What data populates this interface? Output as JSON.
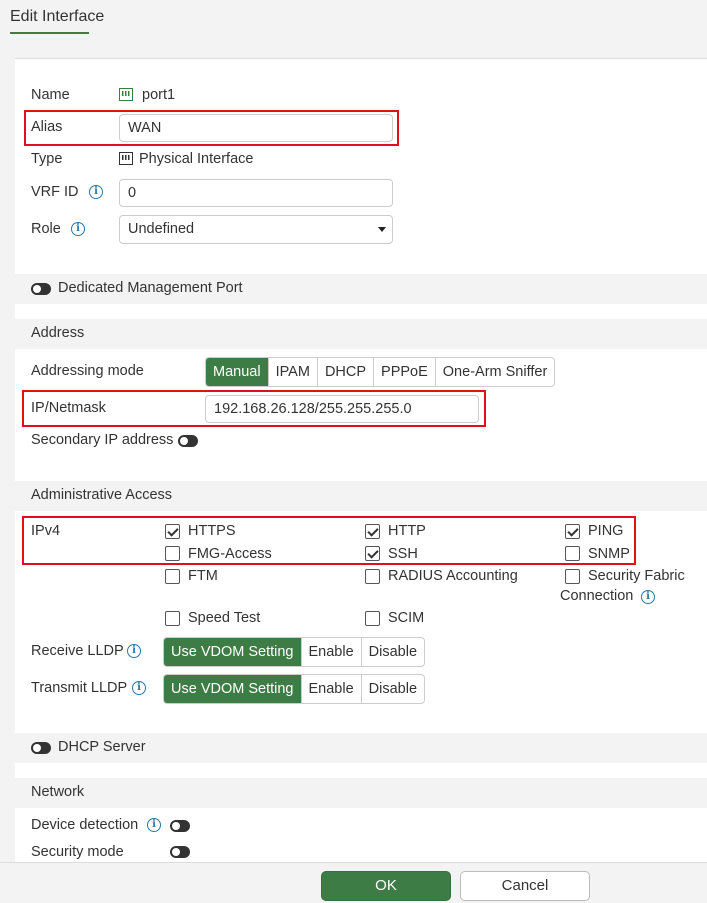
{
  "header": {
    "title": "Edit Interface"
  },
  "fields": {
    "name_label": "Name",
    "name_value": "port1",
    "alias_label": "Alias",
    "alias_value": "WAN",
    "type_label": "Type",
    "type_value": "Physical Interface",
    "vrf_label": "VRF ID",
    "vrf_value": "0",
    "role_label": "Role",
    "role_value": "Undefined"
  },
  "dedicated_mgmt": {
    "label": "Dedicated Management Port",
    "enabled": false
  },
  "address": {
    "section_title": "Address",
    "mode_label": "Addressing mode",
    "modes": [
      "Manual",
      "IPAM",
      "DHCP",
      "PPPoE",
      "One-Arm Sniffer"
    ],
    "selected_mode": "Manual",
    "ip_label": "IP/Netmask",
    "ip_value": "192.168.26.128/255.255.255.0",
    "secondary_label": "Secondary IP address",
    "secondary_enabled": false
  },
  "admin_access": {
    "section_title": "Administrative Access",
    "ipv4_label": "IPv4",
    "options": [
      {
        "label": "HTTPS",
        "checked": true
      },
      {
        "label": "HTTP",
        "checked": true
      },
      {
        "label": "PING",
        "checked": true
      },
      {
        "label": "FMG-Access",
        "checked": false
      },
      {
        "label": "SSH",
        "checked": true
      },
      {
        "label": "SNMP",
        "checked": false
      },
      {
        "label": "FTM",
        "checked": false
      },
      {
        "label": "RADIUS Accounting",
        "checked": false
      },
      {
        "label": "Security Fabric",
        "label2": "Connection",
        "checked": false
      },
      {
        "label": "Speed Test",
        "checked": false
      },
      {
        "label": "SCIM",
        "checked": false
      }
    ],
    "receive_lldp_label": "Receive LLDP",
    "transmit_lldp_label": "Transmit LLDP",
    "lldp_options": [
      "Use VDOM Setting",
      "Enable",
      "Disable"
    ],
    "receive_lldp_selected": "Use VDOM Setting",
    "transmit_lldp_selected": "Use VDOM Setting"
  },
  "dhcp_server": {
    "label": "DHCP Server",
    "enabled": false
  },
  "network": {
    "section_title": "Network",
    "device_detection_label": "Device detection",
    "device_detection_enabled": false,
    "security_mode_label": "Security mode",
    "security_mode_enabled": false
  },
  "footer": {
    "ok_label": "OK",
    "cancel_label": "Cancel"
  },
  "colors": {
    "accent": "#3e7c46",
    "highlight": "#e0101a",
    "info": "#2a78a8"
  }
}
